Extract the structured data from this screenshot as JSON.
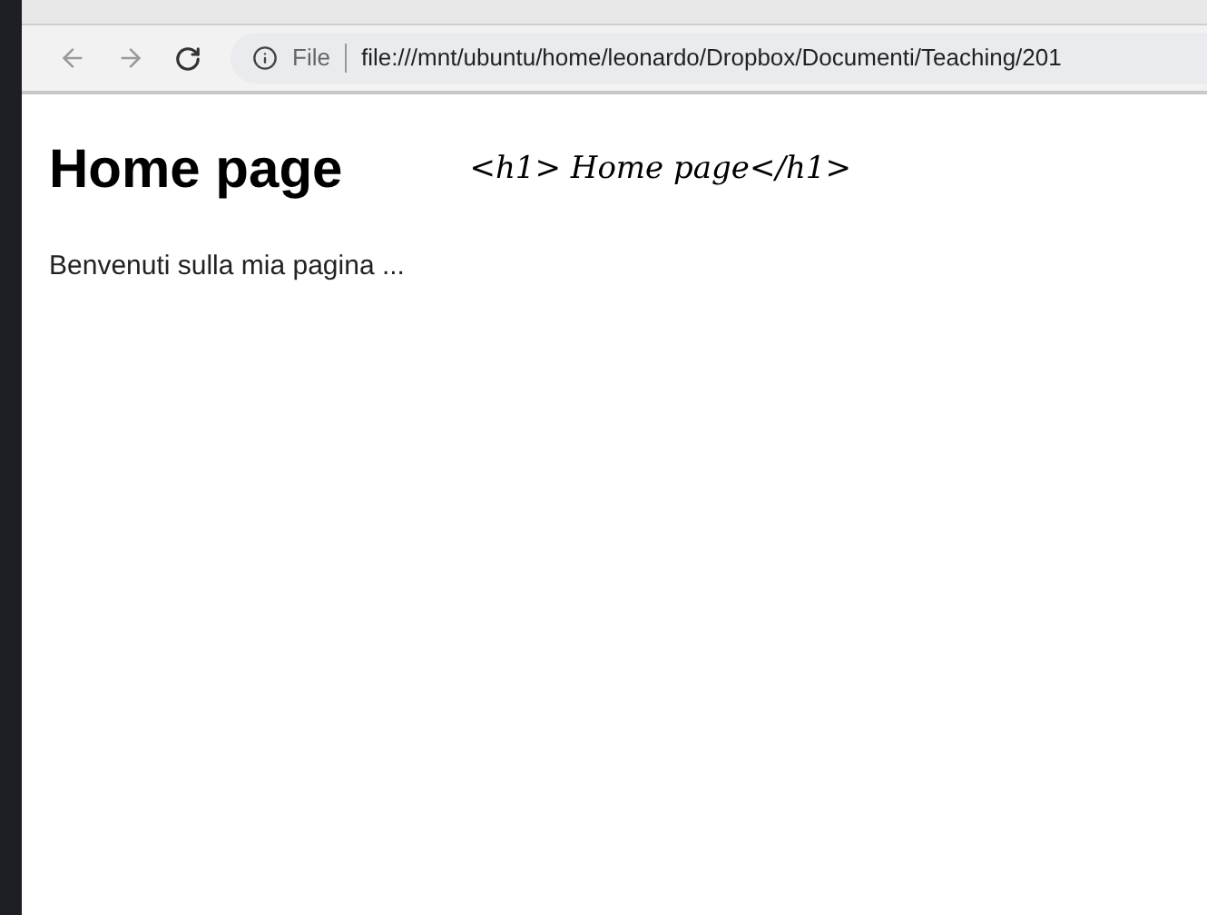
{
  "toolbar": {
    "security_label": "File",
    "url": "file:///mnt/ubuntu/home/leonardo/Dropbox/Documenti/Teaching/201"
  },
  "page": {
    "heading": "Home page",
    "paragraph": "Benvenuti sulla mia pagina ..."
  },
  "annotation": {
    "text": "<h1> Home page</h1>"
  }
}
